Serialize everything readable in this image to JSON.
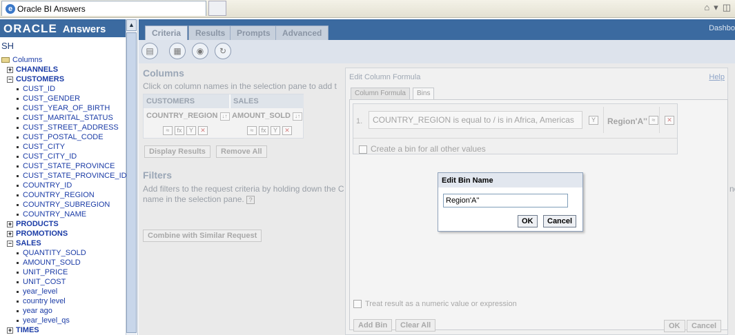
{
  "browser": {
    "tab_title": "Oracle BI Answers",
    "ie_glyph": "e"
  },
  "brand": {
    "oracle": "ORACLE",
    "answers": "Answers"
  },
  "subject_area": "SH",
  "tree": {
    "root": "Columns",
    "items": [
      {
        "type": "folder",
        "expander": "+",
        "label": "CHANNELS"
      },
      {
        "type": "folder",
        "expander": "−",
        "label": "CUSTOMERS"
      },
      {
        "type": "col",
        "label": "CUST_ID"
      },
      {
        "type": "col",
        "label": "CUST_GENDER"
      },
      {
        "type": "col",
        "label": "CUST_YEAR_OF_BIRTH"
      },
      {
        "type": "col",
        "label": "CUST_MARITAL_STATUS"
      },
      {
        "type": "col",
        "label": "CUST_STREET_ADDRESS"
      },
      {
        "type": "col",
        "label": "CUST_POSTAL_CODE"
      },
      {
        "type": "col",
        "label": "CUST_CITY"
      },
      {
        "type": "col",
        "label": "CUST_CITY_ID"
      },
      {
        "type": "col",
        "label": "CUST_STATE_PROVINCE"
      },
      {
        "type": "col",
        "label": "CUST_STATE_PROVINCE_ID"
      },
      {
        "type": "col",
        "label": "COUNTRY_ID"
      },
      {
        "type": "col",
        "label": "COUNTRY_REGION"
      },
      {
        "type": "col",
        "label": "COUNTRY_SUBREGION"
      },
      {
        "type": "col",
        "label": "COUNTRY_NAME"
      },
      {
        "type": "folder",
        "expander": "+",
        "label": "PRODUCTS"
      },
      {
        "type": "folder",
        "expander": "+",
        "label": "PROMOTIONS"
      },
      {
        "type": "folder",
        "expander": "−",
        "label": "SALES"
      },
      {
        "type": "col",
        "label": "QUANTITY_SOLD"
      },
      {
        "type": "col",
        "label": "AMOUNT_SOLD"
      },
      {
        "type": "col",
        "label": "UNIT_PRICE"
      },
      {
        "type": "col",
        "label": "UNIT_COST"
      },
      {
        "type": "col",
        "label": "year_level"
      },
      {
        "type": "col",
        "label": "country level"
      },
      {
        "type": "col",
        "label": "year ago"
      },
      {
        "type": "col",
        "label": "year_level_qs"
      },
      {
        "type": "folder",
        "expander": "+",
        "label": "TIMES"
      }
    ]
  },
  "tabs": [
    {
      "label": "Criteria",
      "active": true
    },
    {
      "label": "Results"
    },
    {
      "label": "Prompts"
    },
    {
      "label": "Advanced"
    }
  ],
  "dashboards_link": "Dashbo",
  "columns_section": {
    "title": "Columns",
    "help": "Click on column names in the selection pane to add t",
    "headers": [
      "CUSTOMERS",
      "SALES"
    ],
    "columns": [
      "COUNTRY_REGION",
      "AMOUNT_SOLD"
    ],
    "sort_glyph": "↓↑",
    "display_results": "Display Results",
    "remove_all": "Remove All"
  },
  "filters_section": {
    "title": "Filters",
    "help_line1": "Add filters to the request criteria by holding down the C",
    "help_line2": "name in the selection pane.",
    "help_glyph": "?",
    "trailing": "nc",
    "combine": "Combine with Similar Request"
  },
  "formula_dialog": {
    "title": "Edit Column Formula",
    "help": "Help",
    "tabs": [
      "Column Formula",
      "Bins"
    ],
    "bin": {
      "number": "1.",
      "condition": "COUNTRY_REGION is equal to / is in Africa, Americas",
      "name": "Region'A''"
    },
    "other_values": "Create a bin for all other values",
    "treat_numeric": "Treat result as a numeric value or expression",
    "add_bin": "Add Bin",
    "clear_all": "Clear All",
    "ok": "OK",
    "cancel": "Cancel"
  },
  "bin_popup": {
    "title": "Edit Bin Name",
    "value": "Region'A''",
    "ok": "OK",
    "cancel": "Cancel"
  },
  "icons": {
    "filter": "Y",
    "formula": "fx",
    "delete": "✕",
    "props": "≈"
  }
}
